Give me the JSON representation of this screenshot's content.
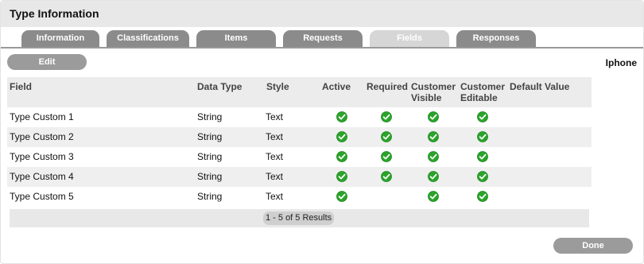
{
  "header": {
    "title": "Type Information"
  },
  "tabs": [
    {
      "label": "Information",
      "active": false
    },
    {
      "label": "Classifications",
      "active": false
    },
    {
      "label": "Items",
      "active": false
    },
    {
      "label": "Requests",
      "active": false
    },
    {
      "label": "Fields",
      "active": true
    },
    {
      "label": "Responses",
      "active": false
    }
  ],
  "toolbar": {
    "edit_label": "Edit",
    "context_name": "Iphone"
  },
  "table": {
    "columns": [
      "Field",
      "Data Type",
      "Style",
      "Active",
      "Required",
      "Customer Visible",
      "Customer Editable",
      "Default Value"
    ],
    "column_lines": {
      "customer_visible": [
        "Customer",
        "Visible"
      ],
      "customer_editable": [
        "Customer",
        "Editable"
      ]
    },
    "rows": [
      {
        "field": "Type Custom 1",
        "data_type": "String",
        "style": "Text",
        "active": true,
        "required": true,
        "customer_visible": true,
        "customer_editable": true,
        "default_value": ""
      },
      {
        "field": "Type Custom 2",
        "data_type": "String",
        "style": "Text",
        "active": true,
        "required": true,
        "customer_visible": true,
        "customer_editable": true,
        "default_value": ""
      },
      {
        "field": "Type Custom 3",
        "data_type": "String",
        "style": "Text",
        "active": true,
        "required": true,
        "customer_visible": true,
        "customer_editable": true,
        "default_value": ""
      },
      {
        "field": "Type Custom 4",
        "data_type": "String",
        "style": "Text",
        "active": true,
        "required": true,
        "customer_visible": true,
        "customer_editable": true,
        "default_value": ""
      },
      {
        "field": "Type Custom 5",
        "data_type": "String",
        "style": "Text",
        "active": true,
        "required": false,
        "customer_visible": true,
        "customer_editable": true,
        "default_value": ""
      }
    ]
  },
  "pager": {
    "text": "1 - 5 of 5 Results"
  },
  "footer": {
    "done_label": "Done"
  },
  "icons": {
    "check": "check-circle-icon"
  },
  "colors": {
    "check_green": "#2aa42a",
    "tab_gray": "#8b8b8b",
    "tab_active": "#d6d6d6"
  }
}
